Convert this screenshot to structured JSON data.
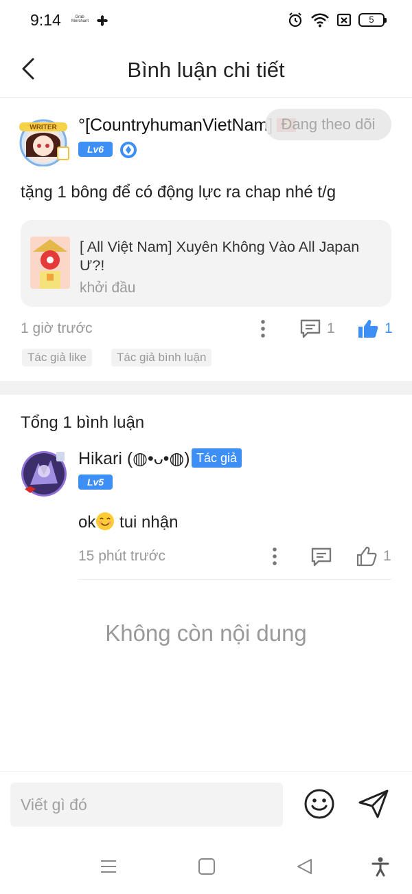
{
  "status_bar": {
    "time": "9:14",
    "grab_label": "Grab Merchant",
    "battery": "5"
  },
  "header": {
    "title": "Bình luận chi tiết"
  },
  "comment": {
    "username": "°[CountryhumanVietNam]",
    "avatar_badge": "WRITER",
    "level": "Lv6",
    "follow_label": "Đang theo dõi",
    "text": "tặng 1 bông để có động lực ra chap nhé t/g",
    "story": {
      "title": "[ All Việt Nam] Xuyên Không Vào All Japan Ư?!",
      "chapter": "khởi đầu"
    },
    "time": "1 giờ trước",
    "reply_count": "1",
    "like_count": "1",
    "tags": [
      "Tác giả like",
      "Tác giả bình luận"
    ]
  },
  "replies": {
    "total_label": "Tổng 1 bình luận",
    "items": [
      {
        "username": "Hikari (◍•ᴗ•◍)",
        "author_badge": "Tác giả",
        "level": "Lv5",
        "text_before": "ok",
        "text_after": " tui nhận",
        "time": "15 phút trước",
        "like_count": "1"
      }
    ]
  },
  "no_more_label": "Không còn nội dung",
  "input": {
    "placeholder": "Viết gì đó"
  },
  "colors": {
    "accent": "#3d8ff5",
    "muted_text": "#999999"
  }
}
